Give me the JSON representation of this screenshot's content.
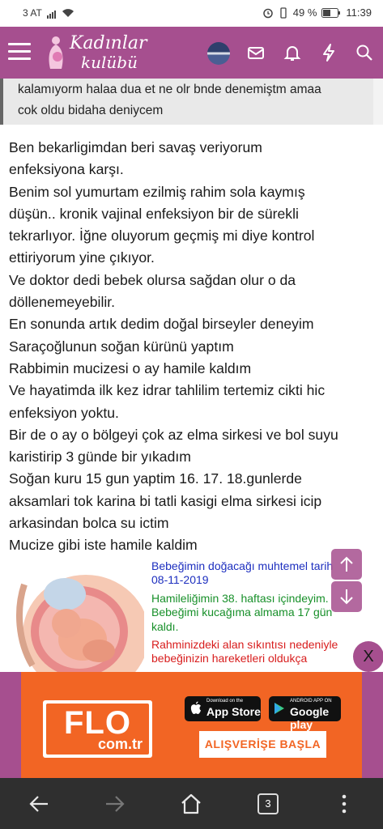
{
  "status_bar": {
    "carrier": "3 AT",
    "battery": "49 %",
    "time": "11:39"
  },
  "header": {
    "logo_line1": "Kadınlar",
    "logo_line2": "kulübü",
    "icons": [
      "menu-icon",
      "avatar",
      "mail-icon",
      "bell-icon",
      "lightning-icon",
      "search-icon"
    ]
  },
  "quote": {
    "lines": [
      "kalamıyorm halaa dua et ne olr bnde denemiştm amaa",
      "cok oldu bidaha deniycem"
    ]
  },
  "post": {
    "lines": [
      "Ben bekarligimdan beri savaş veriyorum",
      "enfeksiyona karşı.",
      "Benim sol yumurtam ezilmiş rahim sola kaymış",
      "düşün.. kronik vajinal enfeksiyon bir de sürekli",
      "tekrarlıyor. İğne oluyorum geçmiş mi diye kontrol",
      "ettiriyorum yine çıkıyor.",
      "Ve doktor dedi bebek olursa sağdan olur o da",
      "döllenemeyebilir.",
      "En sonunda artık dedim doğal birseyler deneyim",
      "Saraçoğlunun soğan kürünü yaptım",
      "Rabbimin mucizesi o ay hamile kaldım",
      "Ve hayatimda ilk kez idrar tahlilim tertemiz cikti hic",
      "enfeksiyon yoktu.",
      "Bir de o ay o bölgeyi çok az elma sirkesi ve bol suyu",
      "karistirip 3 günde bir yıkadım",
      "Soğan kuru 15 gun yaptim 16. 17. 18.gunlerde",
      "aksamlari tok karina bi tatli kasigi elma sirkesi icip",
      "arkasindan bolca su ictim",
      "Mucize gibi iste hamile kaldim"
    ]
  },
  "pregnancy_info": {
    "due_line1": "Bebeğimin doğacağı muhtemel tarih",
    "due_line2": "08-11-2019",
    "week_line1": "Hamileliğimin 38. haftası içindeyim.",
    "week_line2": "Bebeğimi kucağıma almama 17 gün",
    "week_line3": "kaldı.",
    "red_line1": "Rahminizdeki alan sıkıntısı nedeniyle",
    "red_line2": "bebeğinizin hareketleri oldukça"
  },
  "floating": {
    "close_label": "X"
  },
  "ad": {
    "brand": "FLO",
    "domain": "com.tr",
    "app_store_small": "Download on the",
    "app_store_big": "App Store",
    "google_small": "ANDROID APP ON",
    "google_big": "Google play",
    "cta": "ALIŞVERİŞE BAŞLA"
  },
  "nav_bar": {
    "tab_count": "3"
  },
  "colors": {
    "brand_purple": "#a64f8f",
    "ad_orange": "#f26524",
    "due_blue": "#1d2fbf",
    "week_green": "#18902a",
    "warning_red": "#d81d1d"
  }
}
